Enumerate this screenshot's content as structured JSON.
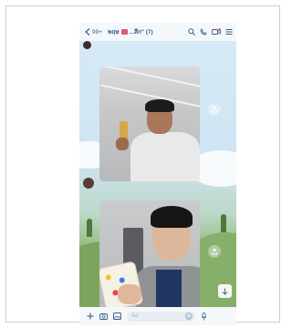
{
  "header": {
    "back_count": "99+",
    "title": "พฤษ",
    "title_suffix": "...ลึก\" (7)"
  },
  "input": {
    "placeholder": "Aa"
  },
  "colors": {
    "accent": "#3a5a8c",
    "badge": "#e0567a"
  },
  "icons": [
    "back-chevron-icon",
    "search-icon",
    "phone-icon",
    "video-call-icon",
    "menu-icon",
    "add-icon",
    "camera-icon",
    "gallery-icon",
    "emoji-icon",
    "mic-icon",
    "scroll-down-icon",
    "share-icon",
    "save-icon"
  ]
}
